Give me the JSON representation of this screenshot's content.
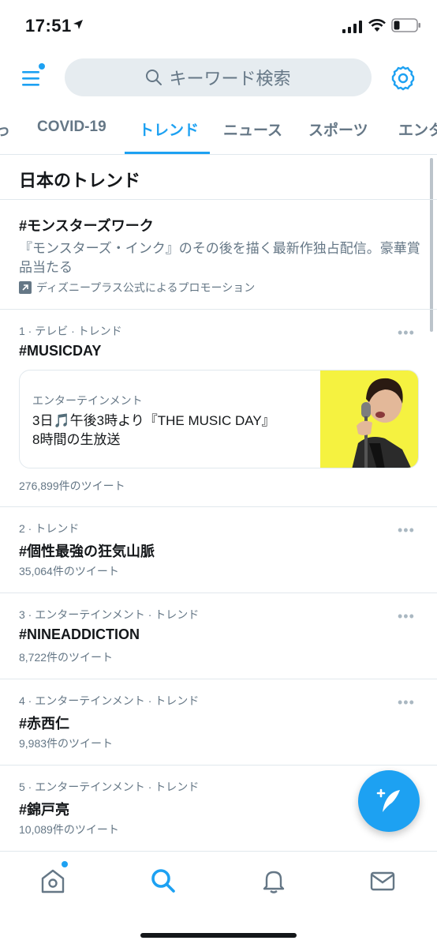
{
  "status_bar": {
    "time": "17:51"
  },
  "header": {
    "search_placeholder": "キーワード検索",
    "icons": [
      "menu-icon",
      "search-icon",
      "gear-icon"
    ]
  },
  "tabs": [
    {
      "label": "COVID-19",
      "active": false
    },
    {
      "label": "トレンド",
      "active": true
    },
    {
      "label": "ニュース",
      "active": false
    },
    {
      "label": "スポーツ",
      "active": false
    },
    {
      "label": "エンタ",
      "active": false
    }
  ],
  "section_title": "日本のトレンド",
  "promoted": {
    "title": "#モンスターズワーク",
    "description": "『モンスターズ・インク』のその後を描く最新作独占配信。豪華賞品当たる",
    "promoted_by": "ディズニープラス公式によるプロモーション"
  },
  "trends": [
    {
      "meta": "1 · テレビ · トレンド",
      "name": "#MUSICDAY",
      "card": {
        "category": "エンターテインメント",
        "headline_line1": "3日🎵午後3時より『THE MUSIC DAY』",
        "headline_line2": "8時間の生放送"
      },
      "count": "276,899件のツイート"
    },
    {
      "meta": "2 · トレンド",
      "name": "#個性最強の狂気山脈",
      "count": "35,064件のツイート"
    },
    {
      "meta": "3 · エンターテインメント · トレンド",
      "name": "#NINEADDICTION",
      "count": "8,722件のツイート"
    },
    {
      "meta": "4 · エンターテインメント · トレンド",
      "name": "#赤西仁",
      "count": "9,983件のツイート"
    },
    {
      "meta": "5 · エンターテインメント · トレンド",
      "name": "#錦戸亮",
      "count": "10,089件のツイート"
    }
  ],
  "more_glyph": "•••",
  "bottom_nav": [
    "home-icon",
    "search-icon",
    "bell-icon",
    "mail-icon"
  ],
  "colors": {
    "accent": "#1da1f2",
    "secondary_text": "#657786",
    "border": "#e1e8ed",
    "thumb_bg": "#f5f240"
  }
}
